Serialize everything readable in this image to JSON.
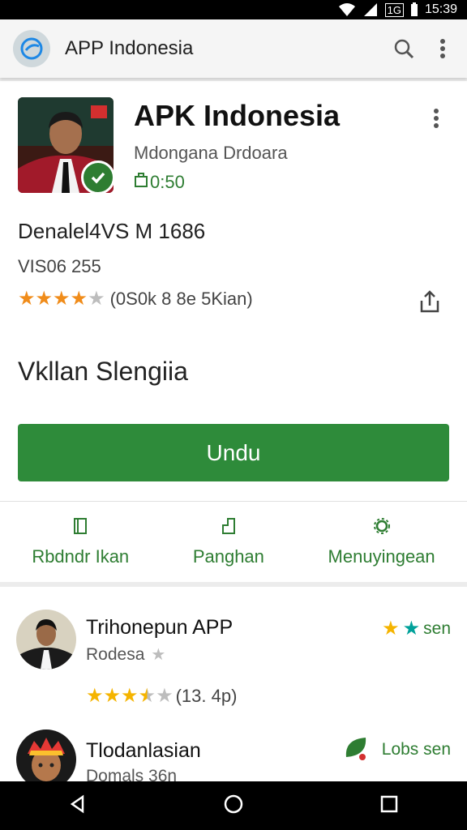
{
  "status_bar": {
    "network": "1G",
    "time": "15:39"
  },
  "toolbar": {
    "title": "APP Indonesia",
    "search_icon": "search-icon",
    "more_icon": "more-vert-icon"
  },
  "app": {
    "name": "APK Indonesia",
    "developer": "Mdongana Drdoara",
    "price": "0:50",
    "version_title": "Denalel4VS M 1686",
    "version_sub": "VIS06 255",
    "rating_text": "(0S0k 8 8e 5Kian)",
    "rating_stars": 4,
    "section_heading": "Vkllan Slengiia",
    "install_label": "Undu",
    "accent_color": "#2e8b3a",
    "star_color": "#f08c1a"
  },
  "actions": [
    {
      "label": "Rbdndr Ikan",
      "icon": "doc-icon"
    },
    {
      "label": "Panghan",
      "icon": "bookmark-icon"
    },
    {
      "label": "Menuyingean",
      "icon": "gear-icon"
    }
  ],
  "list": [
    {
      "title": "Trihonepun APP",
      "subtitle": "Rodesa",
      "rating_text": "(13. 4p)",
      "rating_stars": 3.5,
      "right_label": "sen"
    },
    {
      "title": "Tlodanlasian",
      "subtitle": "Domals 36n",
      "right_label": "Lobs sen"
    }
  ]
}
